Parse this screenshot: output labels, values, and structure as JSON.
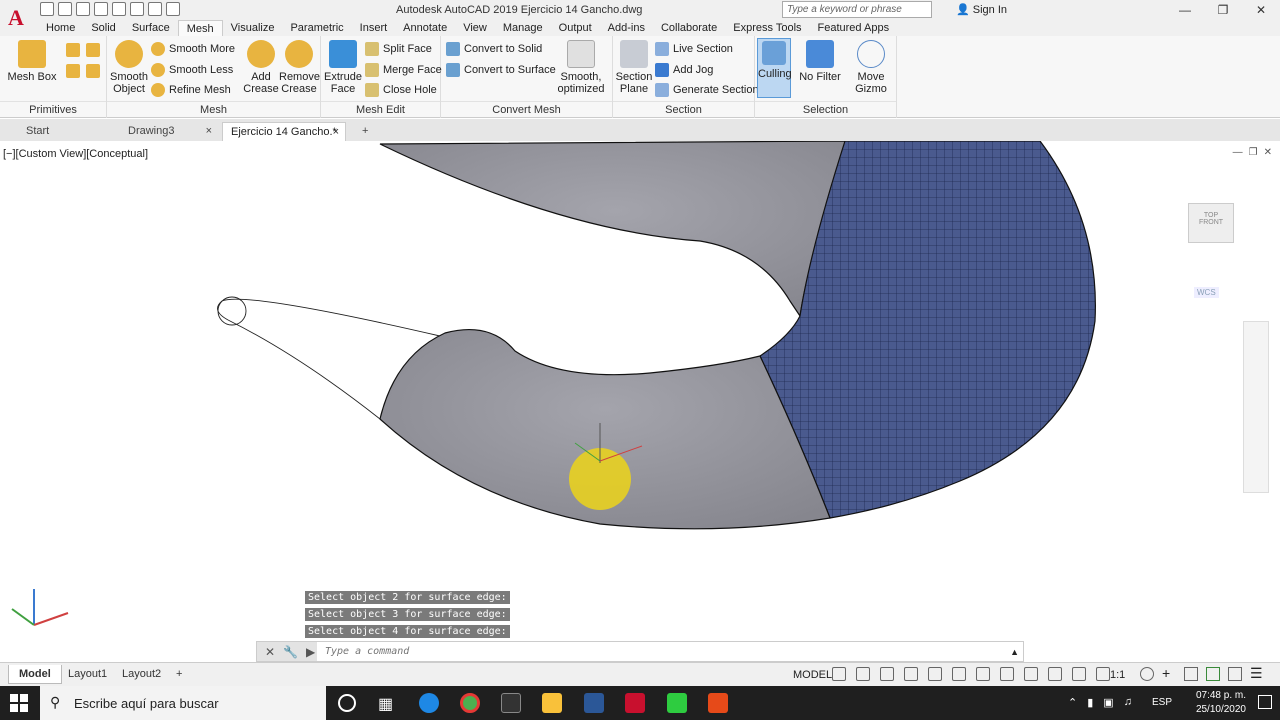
{
  "window": {
    "title": "Autodesk AutoCAD 2019    Ejercicio 14 Gancho.dwg",
    "app_letter": "A",
    "search_placeholder": "Type a keyword or phrase",
    "sign_in": "Sign In"
  },
  "ribbon_tabs": [
    "Home",
    "Solid",
    "Surface",
    "Mesh",
    "Visualize",
    "Parametric",
    "Insert",
    "Annotate",
    "View",
    "Manage",
    "Output",
    "Add-ins",
    "Collaborate",
    "Express Tools",
    "Featured Apps"
  ],
  "active_tab": "Mesh",
  "panels": {
    "primitives": {
      "title": "Primitives",
      "mesh_box": "Mesh Box"
    },
    "mesh": {
      "title": "Mesh",
      "smooth_object": "Smooth Object",
      "smooth_more": "Smooth More",
      "smooth_less": "Smooth Less",
      "refine_mesh": "Refine Mesh",
      "add_crease": "Add Crease",
      "remove_crease": "Remove Crease"
    },
    "mesh_edit": {
      "title": "Mesh Edit",
      "extrude_face": "Extrude Face",
      "split_face": "Split Face",
      "merge_face": "Merge Face",
      "close_hole": "Close Hole"
    },
    "convert_mesh": {
      "title": "Convert Mesh",
      "convert_to_solid": "Convert to Solid",
      "convert_to_surface": "Convert to Surface",
      "smooth_optimized": "Smooth, optimized"
    },
    "section": {
      "title": "Section",
      "section_plane": "Section Plane",
      "live_section": "Live Section",
      "add_jog": "Add Jog",
      "generate_section": "Generate Section"
    },
    "selection": {
      "title": "Selection",
      "culling": "Culling",
      "no_filter": "No Filter",
      "move_gizmo": "Move Gizmo"
    }
  },
  "doc_tabs": [
    "Start",
    "Drawing3",
    "Ejercicio 14 Gancho.*"
  ],
  "view_label": "[−][Custom View][Conceptual]",
  "viewcube": {
    "top": "TOP",
    "front": "FRONT",
    "wcs": "WCS"
  },
  "command_history": [
    "Select object 2 for surface edge:",
    "Select object 3 for surface edge:",
    "Select object 4 for surface edge:"
  ],
  "command_placeholder": "Type a command",
  "layout_tabs": [
    "Model",
    "Layout1",
    "Layout2"
  ],
  "status": {
    "model": "MODEL",
    "scale": "1:1"
  },
  "taskbar": {
    "search": "Escribe aquí para buscar",
    "time": "07:48 p. m.",
    "date": "25/10/2020",
    "lang": "ESP"
  },
  "colors": {
    "mesh_blue": "#4a5a8e",
    "surface_gray": "#9a9aa2",
    "highlight_yellow": "#e8d020",
    "accent": "#c8102e"
  }
}
